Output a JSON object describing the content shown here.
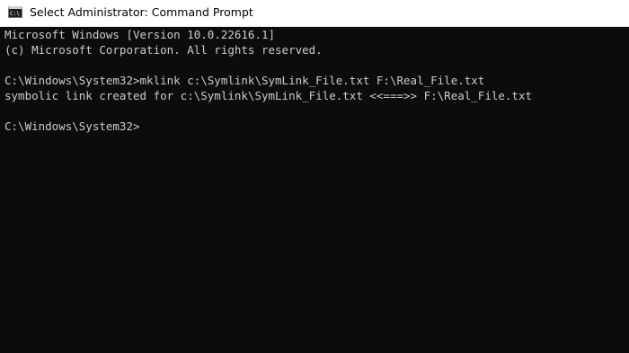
{
  "window": {
    "title": "Select Administrator: Command Prompt",
    "icon": "cmd-icon"
  },
  "console": {
    "lines": [
      "Microsoft Windows [Version 10.0.22616.1]",
      "(c) Microsoft Corporation. All rights reserved.",
      "",
      "C:\\Windows\\System32>mklink c:\\Symlink\\SymLink_File.txt F:\\Real_File.txt",
      "symbolic link created for c:\\Symlink\\SymLink_File.txt <<===>> F:\\Real_File.txt",
      "",
      "C:\\Windows\\System32>"
    ]
  },
  "colors": {
    "console_background": "#0c0c0c",
    "console_text": "#cccccc",
    "titlebar_background": "#ffffff"
  }
}
